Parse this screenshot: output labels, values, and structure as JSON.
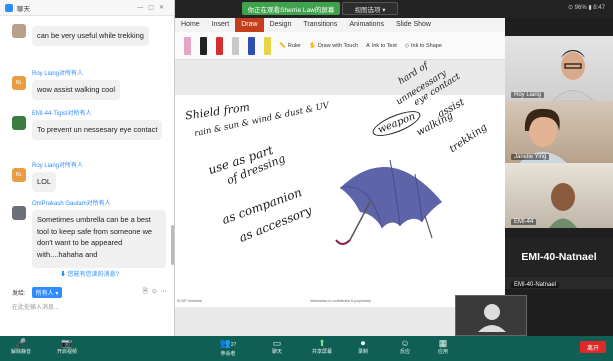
{
  "zoom_bar": {
    "share_banner": "你正在观看Sherrie Law的屏幕",
    "view_options": "视图选项 ▾",
    "status": "⊙ 96% ▮ 8:47"
  },
  "ppt": {
    "tabs": [
      "Home",
      "Insert",
      "Draw",
      "Design",
      "Transitions",
      "Animations",
      "Slide Show"
    ],
    "active_tab": "Draw",
    "tools": {
      "ruler": "Ruler",
      "draw_touch": "Draw with Touch",
      "ink_to_text": "Ink to Text",
      "ink_to_shape": "Ink to Shape"
    },
    "pen_colors": [
      "#e7a4c6",
      "#222222",
      "#d43030",
      "#c8c8c8",
      "#2f4fb0",
      "#e8d64a"
    ]
  },
  "slide": {
    "handwriting": {
      "shield1": "Shield from",
      "shield2": "rain & sun & wind & dust & UV",
      "use_as1": "use as part",
      "use_as2": "of dressing",
      "companion1": "as companion",
      "companion2": "as accessory",
      "weapon": "weapon",
      "hard_of1": "hard of",
      "hard_of2": "unnecessary",
      "hard_of3": "eye contact",
      "assist1": "assist",
      "assist2": "walking",
      "trekking": "trekking"
    },
    "footer_left": "SCHP Umbrella",
    "footer_mid": "Information in confidential & proprietary"
  },
  "chat": {
    "title": "聊天",
    "messages": [
      {
        "sender": "",
        "avatar": "",
        "color": "#b9a08a",
        "text": "can be very useful while trekking"
      },
      {
        "sender": "Roy Liang对所有人",
        "avatar": "RL",
        "color": "#e89d42",
        "text": "wow assist walking cool"
      },
      {
        "sender": "EMI-44-Tigist对所有人",
        "avatar": "",
        "color": "#3a7d3e",
        "text": "To prevent un nessesary eye contact"
      },
      {
        "sender": "Roy Liang对所有人",
        "avatar": "RL",
        "color": "#e89d42",
        "text": "LOL"
      },
      {
        "sender": "OmPrakash Gautam对所有人",
        "avatar": "",
        "color": "#6b6f78",
        "text": "Sometimes umbrella can be a best tool to keep safe from someone we don't want to be appeared with....hahaha  and"
      }
    ],
    "unread_notice": "⬇ 您能有您读的消息?",
    "send_label": "发给:",
    "send_to": "所有人 ▾",
    "input_placeholder": "在此处输入消息..."
  },
  "videos": [
    {
      "name": "Roy Liang"
    },
    {
      "name": "Janelle Ying"
    },
    {
      "name": "EMI-44"
    },
    {
      "name": "EMI-40-Natnael"
    }
  ],
  "big_name": "EMI-40-Natnael",
  "toolbar": {
    "items": [
      {
        "icon": "🎤",
        "label": "解除静音"
      },
      {
        "icon": "📷",
        "label": "开启视频"
      },
      {
        "icon": "👥",
        "label": "参会者"
      },
      {
        "icon": "▭",
        "label": "聊天"
      },
      {
        "icon": "⬆",
        "label": "共享屏幕"
      },
      {
        "icon": "⏺",
        "label": "录制"
      },
      {
        "icon": "☺",
        "label": "反应"
      },
      {
        "icon": "▦",
        "label": "应用"
      }
    ],
    "participant_count": "27",
    "leave": "离开"
  }
}
